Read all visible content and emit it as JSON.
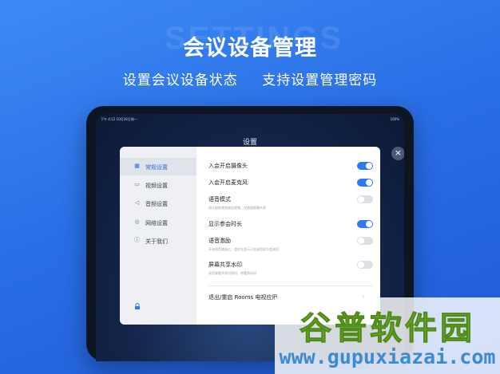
{
  "bg_word": "SETTINGS",
  "headline": "会议设备管理",
  "subline": [
    "设置会议设备状态",
    "支持设置管理密码"
  ],
  "status_bar": {
    "left": "下午 4:12   10月26日周一",
    "right": "100%"
  },
  "settings_title": "设置",
  "close_icon": "×",
  "sidebar": [
    {
      "icon": "grid-icon",
      "label": "常规设置",
      "active": true
    },
    {
      "icon": "video-icon",
      "label": "视频设置",
      "active": false
    },
    {
      "icon": "speaker-icon",
      "label": "音频设置",
      "active": false
    },
    {
      "icon": "globe-icon",
      "label": "网络设置",
      "active": false
    },
    {
      "icon": "info-icon",
      "label": "关于我们",
      "active": false
    }
  ],
  "settings": [
    {
      "title": "入会开启摄像头",
      "desc": "",
      "on": true
    },
    {
      "title": "入会开启麦克风",
      "desc": "",
      "on": true
    },
    {
      "title": "语音模式",
      "desc": "停止接收其他成员视频，仅保留屏幕共享",
      "on": false
    },
    {
      "title": "显示参会时长",
      "desc": "",
      "on": true
    },
    {
      "title": "语音激励",
      "desc": "开启语音激励后，会优先显示正在说话的与会成员",
      "on": false
    },
    {
      "title": "屏幕共享水印",
      "desc": "成员观看共享内容时，将看到水印",
      "on": false
    }
  ],
  "exit_label": "退出/重启 Rooms 电视应用",
  "colors": {
    "accent": "#2f7af0",
    "background": "#2a6fe6"
  },
  "watermark": {
    "cn": "谷普软件园",
    "url": "www.gupuxiazai.com"
  }
}
